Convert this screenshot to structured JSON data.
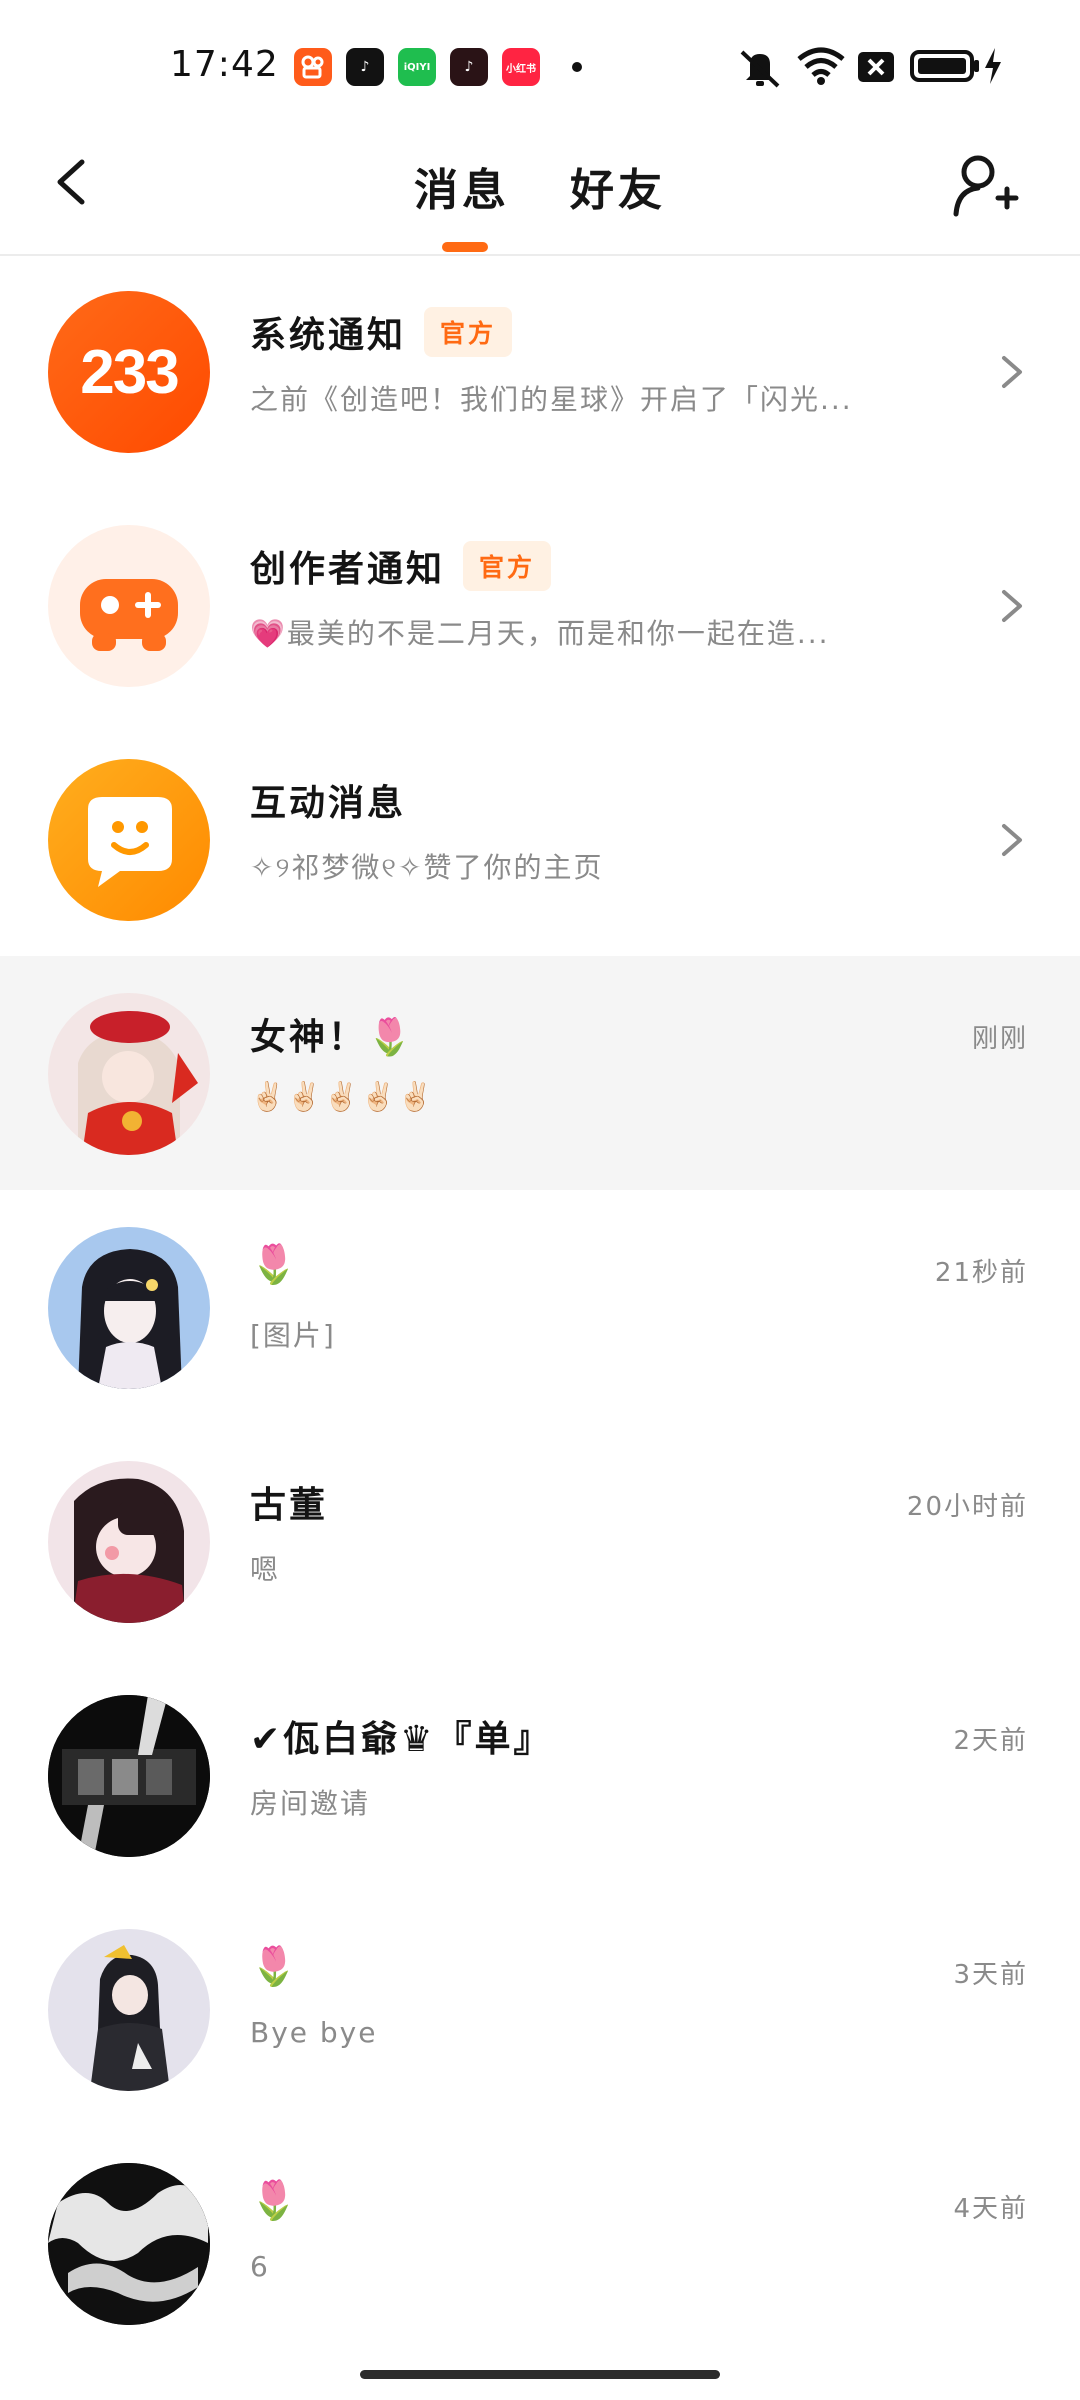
{
  "status_bar": {
    "time": "17:42",
    "app_icons": [
      {
        "name": "kuaishou-icon",
        "label": "",
        "color": "#ff5b1a"
      },
      {
        "name": "douyin-icon",
        "label": "♪",
        "color": "#121212"
      },
      {
        "name": "iqiyi-icon",
        "label": "iQIYI",
        "color": "#1fbe4f"
      },
      {
        "name": "douyin-icon",
        "label": "♪",
        "color": "#2a1316"
      },
      {
        "name": "xiaohongshu-icon",
        "label": "小红书",
        "color": "#ff2442"
      }
    ],
    "icons": [
      "mute-icon",
      "wifi-icon",
      "sim-off-icon",
      "battery-icon",
      "charging-icon"
    ]
  },
  "header": {
    "tabs": [
      {
        "label": "消息",
        "active": true
      },
      {
        "label": "好友",
        "active": false
      }
    ],
    "accent_color": "#ff6a13"
  },
  "conversations": [
    {
      "title": "系统通知",
      "badge": "官方",
      "subtitle": "之前《创造吧！我们的星球》开启了「闪光...",
      "time": "",
      "avatar": "system-233-avatar",
      "avatar_text": "233"
    },
    {
      "title": "创作者通知",
      "badge": "官方",
      "subtitle": "💗最美的不是二月天，而是和你一起在造...",
      "time": "",
      "avatar": "creator-gamepad-avatar"
    },
    {
      "title": "互动消息",
      "badge": "",
      "subtitle": "✧୨祁梦微୧✧赞了你的主页",
      "time": "",
      "avatar": "interaction-chat-avatar"
    },
    {
      "title": "女神！🌷",
      "badge": "",
      "subtitle": "✌🏻✌🏻✌🏻✌🏻✌🏻",
      "time": "刚刚",
      "avatar": "user-avatar"
    },
    {
      "title": "🌷",
      "badge": "",
      "subtitle": "[图片]",
      "time": "21秒前",
      "avatar": "user-avatar"
    },
    {
      "title": "古董",
      "badge": "",
      "subtitle": "嗯",
      "time": "20小时前",
      "avatar": "user-avatar"
    },
    {
      "title": "✔佤白爺♛『单』",
      "badge": "",
      "subtitle": "房间邀请",
      "time": "2天前",
      "avatar": "user-avatar"
    },
    {
      "title": "🌷",
      "badge": "",
      "subtitle": "Bye bye",
      "time": "3天前",
      "avatar": "user-avatar"
    },
    {
      "title": "🌷",
      "badge": "",
      "subtitle": "6",
      "time": "4天前",
      "avatar": "user-avatar"
    }
  ]
}
